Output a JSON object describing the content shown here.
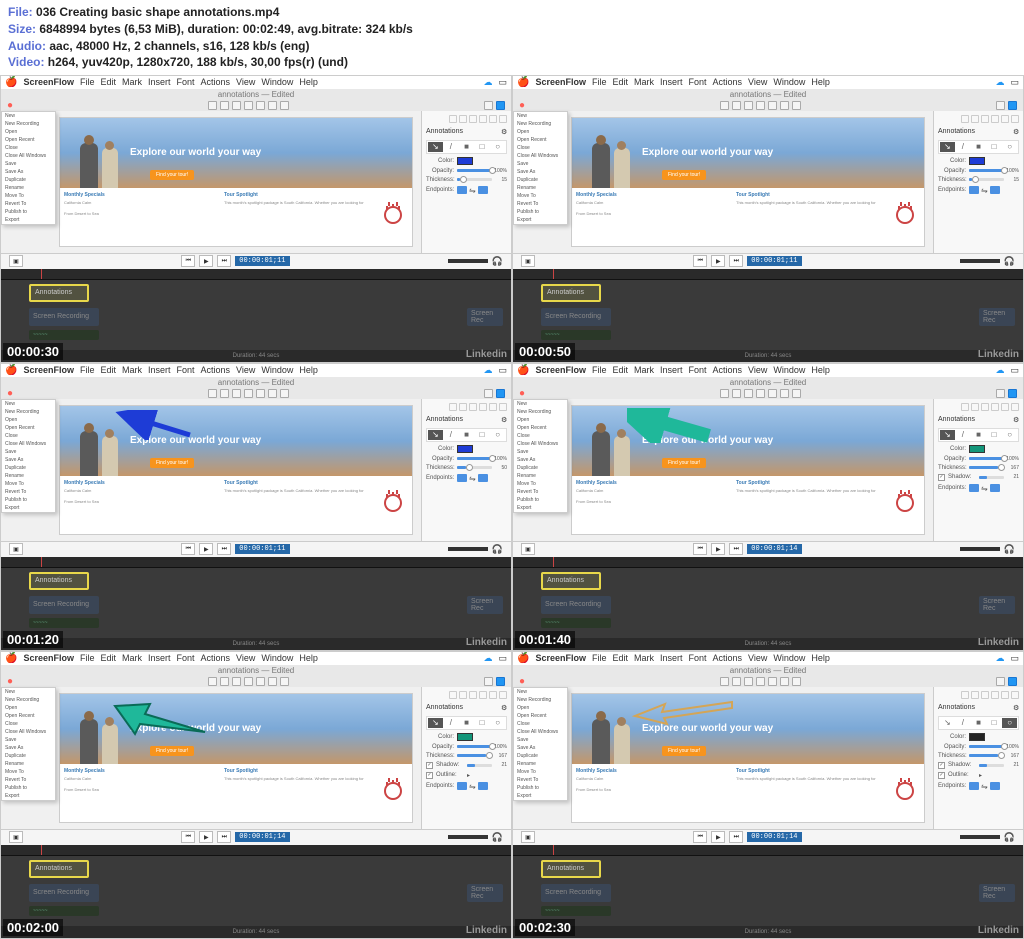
{
  "meta": {
    "file_label": "File:",
    "file_value": "036 Creating basic shape annotations.mp4",
    "size_label": "Size:",
    "size_value": "6848994 bytes (6,53 MiB), duration: 00:02:49, avg.bitrate: 324 kb/s",
    "audio_label": "Audio:",
    "audio_value": "aac, 48000 Hz, 2 channels, s16, 128 kb/s (eng)",
    "video_label": "Video:",
    "video_value": "h264, yuv420p, 1280x720, 188 kb/s, 30,00 fps(r) (und)"
  },
  "menubar": {
    "app": "ScreenFlow",
    "items": [
      "File",
      "Edit",
      "Mark",
      "Insert",
      "Font",
      "Actions",
      "View",
      "Window",
      "Help"
    ]
  },
  "window_title": "annotations — Edited",
  "website": {
    "hero_text": "Explore our world your way",
    "cta": "Find your tour!",
    "monthly": "Monthly Specials",
    "california": "California Calm",
    "desert": "From Desert to Sea",
    "spotlight_title": "Tour Spotlight",
    "spotlight_text": "This month's spotlight package is South California. Whether you are looking for some serious downwind winds or a relaxing stroll along the coast, you'll find something to love in SoCal."
  },
  "dropdown_items": [
    "New",
    "New Recording",
    "Open",
    "Open Recent",
    "Close",
    "Close All Windows",
    "Save",
    "Save As",
    "Duplicate",
    "Rename",
    "Move To",
    "Revert To",
    "Publish to",
    "Export"
  ],
  "panel": {
    "title": "Annotations",
    "props": {
      "color": "Color:",
      "opacity": "Opacity:",
      "thickness": "Thickness:",
      "shadow": "Shadow:",
      "outline": "Outline:",
      "endpoints": "Endpoints:"
    }
  },
  "playback": {
    "timecode": "00:00:01;11",
    "timecode_alt": "00:00:01;14"
  },
  "timeline": {
    "annotations": "Annotations",
    "recording": "Screen Recording",
    "rec_right": "Screen Rec",
    "duration": "Duration: 44 secs"
  },
  "linkedin": "Linkedin",
  "thumbs": [
    {
      "ts": "00:00:30",
      "tc": "00:00:01;11",
      "arrow": "none",
      "tool_sel": 0,
      "color": "#1e3cd6",
      "opacity": 100,
      "thickness": 15,
      "shadow": null,
      "outline": null
    },
    {
      "ts": "00:00:50",
      "tc": "00:00:01;11",
      "arrow": "none",
      "tool_sel": 0,
      "color": "#1e3cd6",
      "opacity": 100,
      "thickness": 15,
      "shadow": null,
      "outline": null
    },
    {
      "ts": "00:01:20",
      "tc": "00:00:01;11",
      "arrow": "blue",
      "tool_sel": 0,
      "color": "#1e3cd6",
      "opacity": 100,
      "thickness": 50,
      "shadow": null,
      "outline": null
    },
    {
      "ts": "00:01:40",
      "tc": "00:00:01;14",
      "arrow": "teal",
      "tool_sel": 0,
      "color": "#13967a",
      "opacity": 100,
      "thickness": 167,
      "shadow": true,
      "outline": null
    },
    {
      "ts": "00:02:00",
      "tc": "00:00:01;14",
      "arrow": "teal-big",
      "tool_sel": 0,
      "color": "#13967a",
      "opacity": 100,
      "thickness": 167,
      "shadow": true,
      "outline": true
    },
    {
      "ts": "00:02:30",
      "tc": "00:00:01;14",
      "arrow": "outline",
      "tool_sel": 4,
      "color": "#222222",
      "opacity": 100,
      "thickness": 167,
      "shadow": true,
      "outline": true
    }
  ]
}
